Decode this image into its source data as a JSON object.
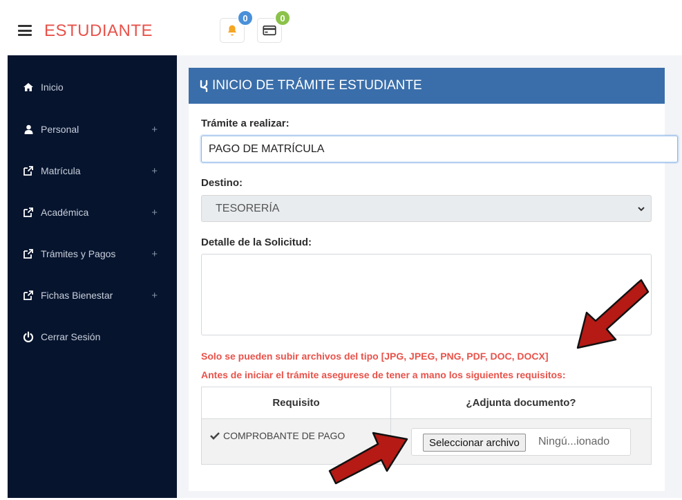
{
  "header": {
    "brand": "ESTUDIANTE",
    "notifications_count": "0",
    "payments_count": "0",
    "colors": {
      "brand": "#e8524a",
      "badge_blue": "#4a90d9",
      "badge_green": "#8bc34a",
      "bell": "#f5a623"
    }
  },
  "sidebar": {
    "items": [
      {
        "label": "Inicio",
        "icon": "home-icon",
        "expandable": false
      },
      {
        "label": "Personal",
        "icon": "user-icon",
        "expandable": true,
        "expand_symbol": "+"
      },
      {
        "label": "Matrícula",
        "icon": "external-link-icon",
        "expandable": true,
        "expand_symbol": "+"
      },
      {
        "label": "Académica",
        "icon": "external-link-icon",
        "expandable": true,
        "expand_symbol": "+"
      },
      {
        "label": "Trámites y Pagos",
        "icon": "external-link-icon",
        "expandable": true,
        "expand_symbol": "+"
      },
      {
        "label": "Fichas Bienestar",
        "icon": "external-link-icon",
        "expandable": true,
        "expand_symbol": "+"
      },
      {
        "label": "Cerrar Sesión",
        "icon": "power-icon",
        "expandable": false
      }
    ]
  },
  "form": {
    "title": "INICIO DE TRÁMITE ESTUDIANTE",
    "tramite_label": "Trámite a realizar:",
    "tramite_value": "PAGO DE MATRÍCULA",
    "destino_label": "Destino:",
    "destino_value": "TESORERÍA",
    "detalle_label": "Detalle de la Solicitud:",
    "detalle_value": "",
    "warning_file_types": "Solo se pueden subir archivos del tipo [JPG, JPEG, PNG, PDF, DOC, DOCX]",
    "warning_requirements": "Antes de iniciar el trámite asegurese de tener a mano los siguientes requisitos:"
  },
  "requirements_table": {
    "columns": [
      "Requisito",
      "¿Adjunta documento?"
    ],
    "rows": [
      {
        "requisito": "COMPROBANTE DE PAGO",
        "file_button": "Seleccionar archivo",
        "file_status": "Ningú...ionado"
      }
    ]
  }
}
